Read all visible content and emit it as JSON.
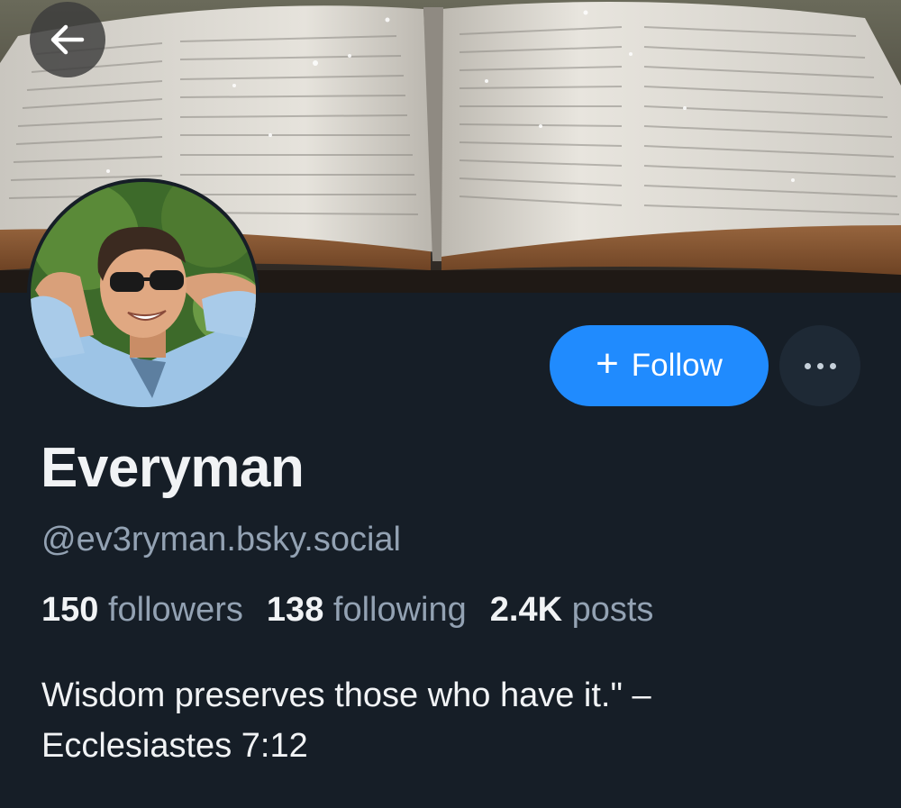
{
  "profile": {
    "display_name": "Everyman",
    "handle": "@ev3ryman.bsky.social",
    "followers_count": "150",
    "followers_label": "followers",
    "following_count": "138",
    "following_label": "following",
    "posts_count": "2.4K",
    "posts_label": "posts",
    "bio_lines": [
      "Wisdom preserves those who have it.\" –",
      "Ecclesiastes 7:12"
    ]
  },
  "actions": {
    "follow_label": "Follow",
    "follow_icon": "plus-icon",
    "more_icon": "ellipsis-icon",
    "back_icon": "arrow-left-icon"
  },
  "colors": {
    "background": "#161e27",
    "accent": "#208bfe",
    "text_primary": "#f1f3f5",
    "text_secondary": "#93a2b3"
  }
}
